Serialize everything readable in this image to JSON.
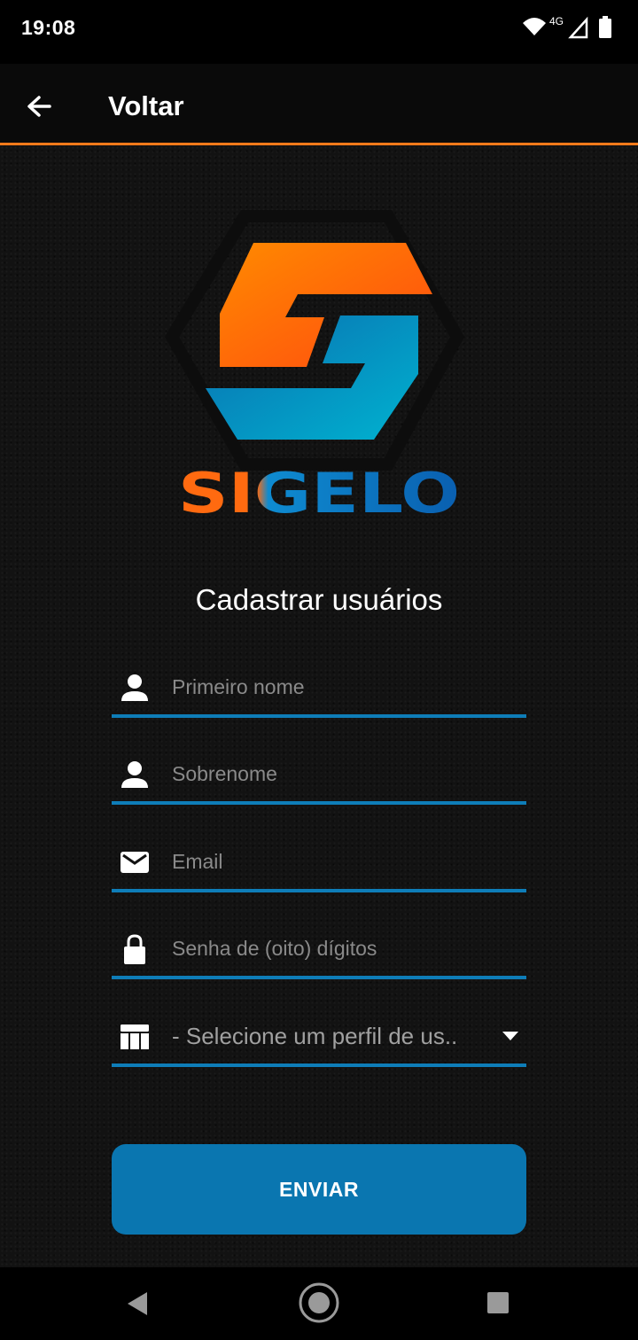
{
  "status_bar": {
    "time": "19:08",
    "network_label": "4G",
    "icons": [
      "wifi-icon",
      "cell-signal-icon",
      "battery-icon"
    ]
  },
  "app_bar": {
    "title": "Voltar",
    "back_icon": "arrow-left-icon"
  },
  "logo": {
    "brand_text": "SIGELO",
    "colors": {
      "orange": "#ff6a10",
      "blue": "#0a8fc9"
    }
  },
  "form": {
    "title": "Cadastrar usuários",
    "fields": {
      "first_name": {
        "placeholder": "Primeiro nome",
        "icon": "person-icon"
      },
      "last_name": {
        "placeholder": "Sobrenome",
        "icon": "person-icon"
      },
      "email": {
        "placeholder": "Email",
        "icon": "mail-icon"
      },
      "password": {
        "placeholder": "Senha de (oito) dígitos",
        "icon": "lock-icon"
      },
      "profile": {
        "selected": "- Selecione um perfil de us..",
        "icon": "table-icon"
      }
    },
    "submit_label": "ENVIAR"
  },
  "colors": {
    "accent_orange": "#ff7a1a",
    "accent_blue": "#0a76b0",
    "underline": "#0e7db8"
  }
}
